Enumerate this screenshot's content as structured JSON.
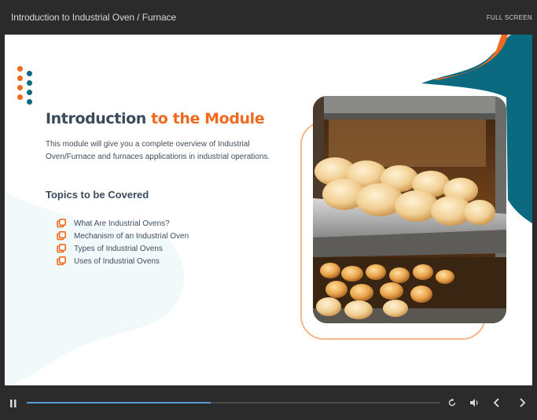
{
  "header": {
    "title": "Introduction to Industrial Oven / Furnace",
    "fullscreen_label": "FULL SCREEN"
  },
  "slide": {
    "title_part1": "Introduction",
    "title_part2": "to the Module",
    "intro": "This module will give you a complete overview of Industrial Oven/Furnace and furnaces applications in industrial operations.",
    "topics_heading": "Topics to be Covered",
    "topics": [
      "What Are Industrial Ovens?",
      "Mechanism of an Industrial Oven",
      "Types of Industrial Ovens",
      "Uses of Industrial Ovens"
    ],
    "image": "bread-rolls-in-oven-photo"
  },
  "colors": {
    "accent_orange": "#ee6a1e",
    "teal": "#0c6a80",
    "heading_text": "#3b4a5a",
    "progress": "#5b9bd5"
  },
  "player": {
    "progress_fraction": 0.445,
    "icons": [
      "pause-icon",
      "replay-icon",
      "volume-icon",
      "previous-icon",
      "next-icon"
    ]
  }
}
